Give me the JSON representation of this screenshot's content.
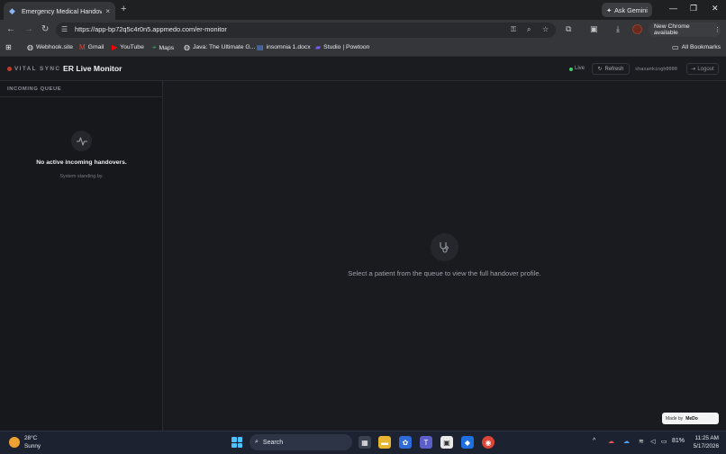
{
  "browser": {
    "tab_title": "Emergency Medical Handover",
    "tab_close": "×",
    "new_tab": "+",
    "url": "https://app-bp72q5c4r0n5.appmedo.com/er-monitor",
    "ask_gemini": "Ask Gemini",
    "new_chrome": "New Chrome available",
    "bookmarks": [
      {
        "label": "Webhook.site",
        "icon": "globe-icon"
      },
      {
        "label": "Gmail",
        "icon": "gmail-icon"
      },
      {
        "label": "YouTube",
        "icon": "youtube-icon"
      },
      {
        "label": "Maps",
        "icon": "maps-icon"
      },
      {
        "label": "Java: The Ultimate G...",
        "icon": "globe-icon"
      },
      {
        "label": "insomnia 1.docx",
        "icon": "doc-icon"
      },
      {
        "label": "Studio | Powtoon",
        "icon": "powtoon-icon"
      }
    ],
    "all_bookmarks": "All Bookmarks"
  },
  "app": {
    "brand": "VITAL SYNC",
    "title": "ER Live Monitor",
    "live": "Live",
    "refresh": "Refresh",
    "user": "shaxankingh0000",
    "logout": "Logout",
    "accent": "#c0392b",
    "live_color": "#3ecf6e"
  },
  "sidebar": {
    "title": "INCOMING QUEUE",
    "empty_title": "No active incoming handovers.",
    "empty_sub": "System standing by."
  },
  "main": {
    "message": "Select a patient from the queue to view the full handover profile."
  },
  "badge": {
    "made_by": "Made by",
    "brand": "MeDo",
    "close": "×"
  },
  "taskbar": {
    "temp": "28°C",
    "condition": "Sunny",
    "search": "Search",
    "battery": "81%",
    "time": "11:25 AM",
    "date": "5/17/2026"
  }
}
